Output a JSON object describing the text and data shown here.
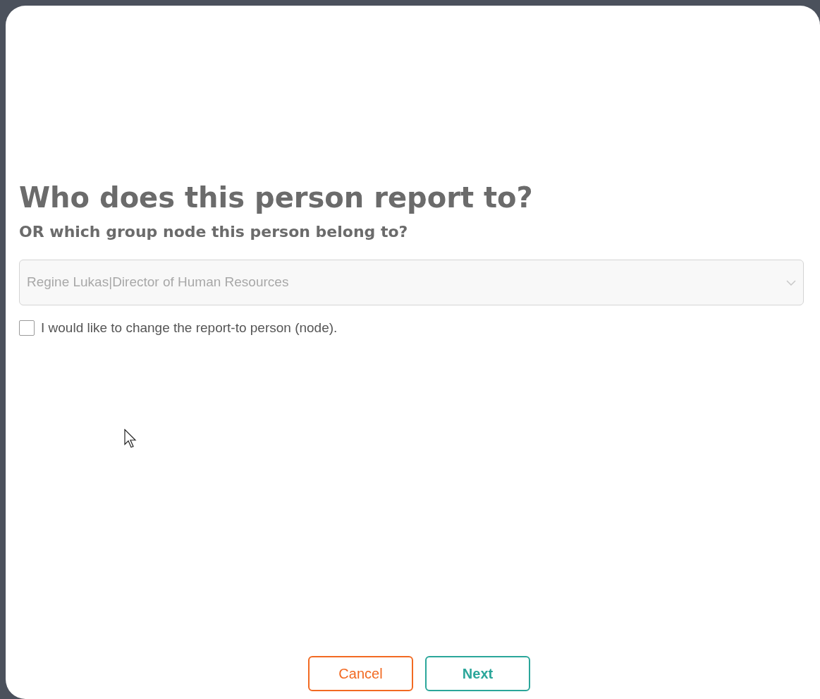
{
  "dialog": {
    "title": "Who does this person report to?",
    "subtitle": "OR which group node this person belong to?",
    "report_to_field": {
      "value": "Regine Lukas|Director of Human Resources",
      "disabled": true
    },
    "change_checkbox": {
      "label": "I would like to change the report-to person (node).",
      "checked": false
    },
    "buttons": [
      {
        "label": "Cancel",
        "kind": "secondary"
      },
      {
        "label": "Next",
        "kind": "primary"
      }
    ]
  }
}
